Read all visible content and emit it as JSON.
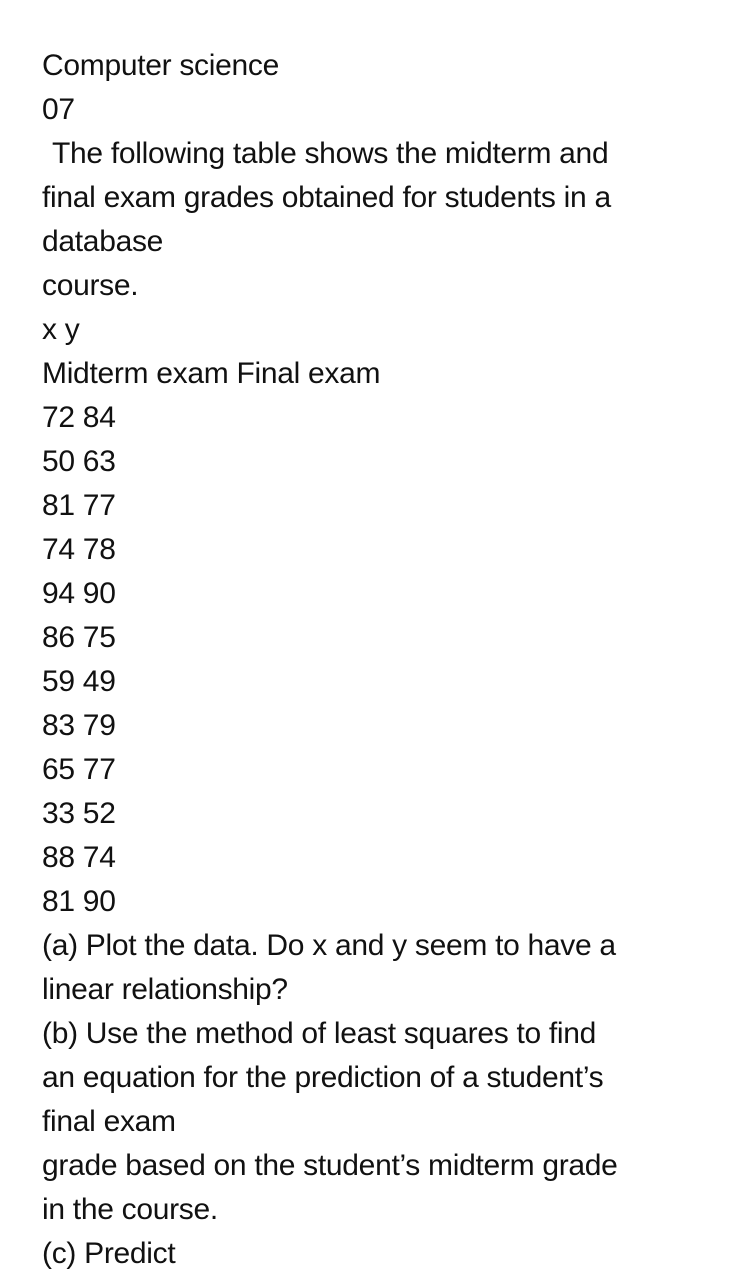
{
  "document": {
    "title": "Computer science",
    "number": "07",
    "intro_lines": [
      "The following table shows the midterm and",
      "final exam grades obtained for students in a",
      "database",
      "course."
    ],
    "table": {
      "variable_header": "x y",
      "column_header": "Midterm exam Final exam",
      "rows": [
        "72 84",
        "50 63",
        "81 77",
        "74 78",
        "94 90",
        "86 75",
        "59 49",
        "83 79",
        "65 77",
        "33 52",
        "88 74",
        "81 90"
      ]
    },
    "question_lines": [
      "(a) Plot the data. Do x and y seem to have a",
      "linear relationship?",
      "(b) Use the method of least squares to find",
      "an equation for the prediction of a student’s",
      "final exam",
      "grade based on the student’s midterm grade",
      "in the course.",
      "(c) Predict"
    ]
  }
}
